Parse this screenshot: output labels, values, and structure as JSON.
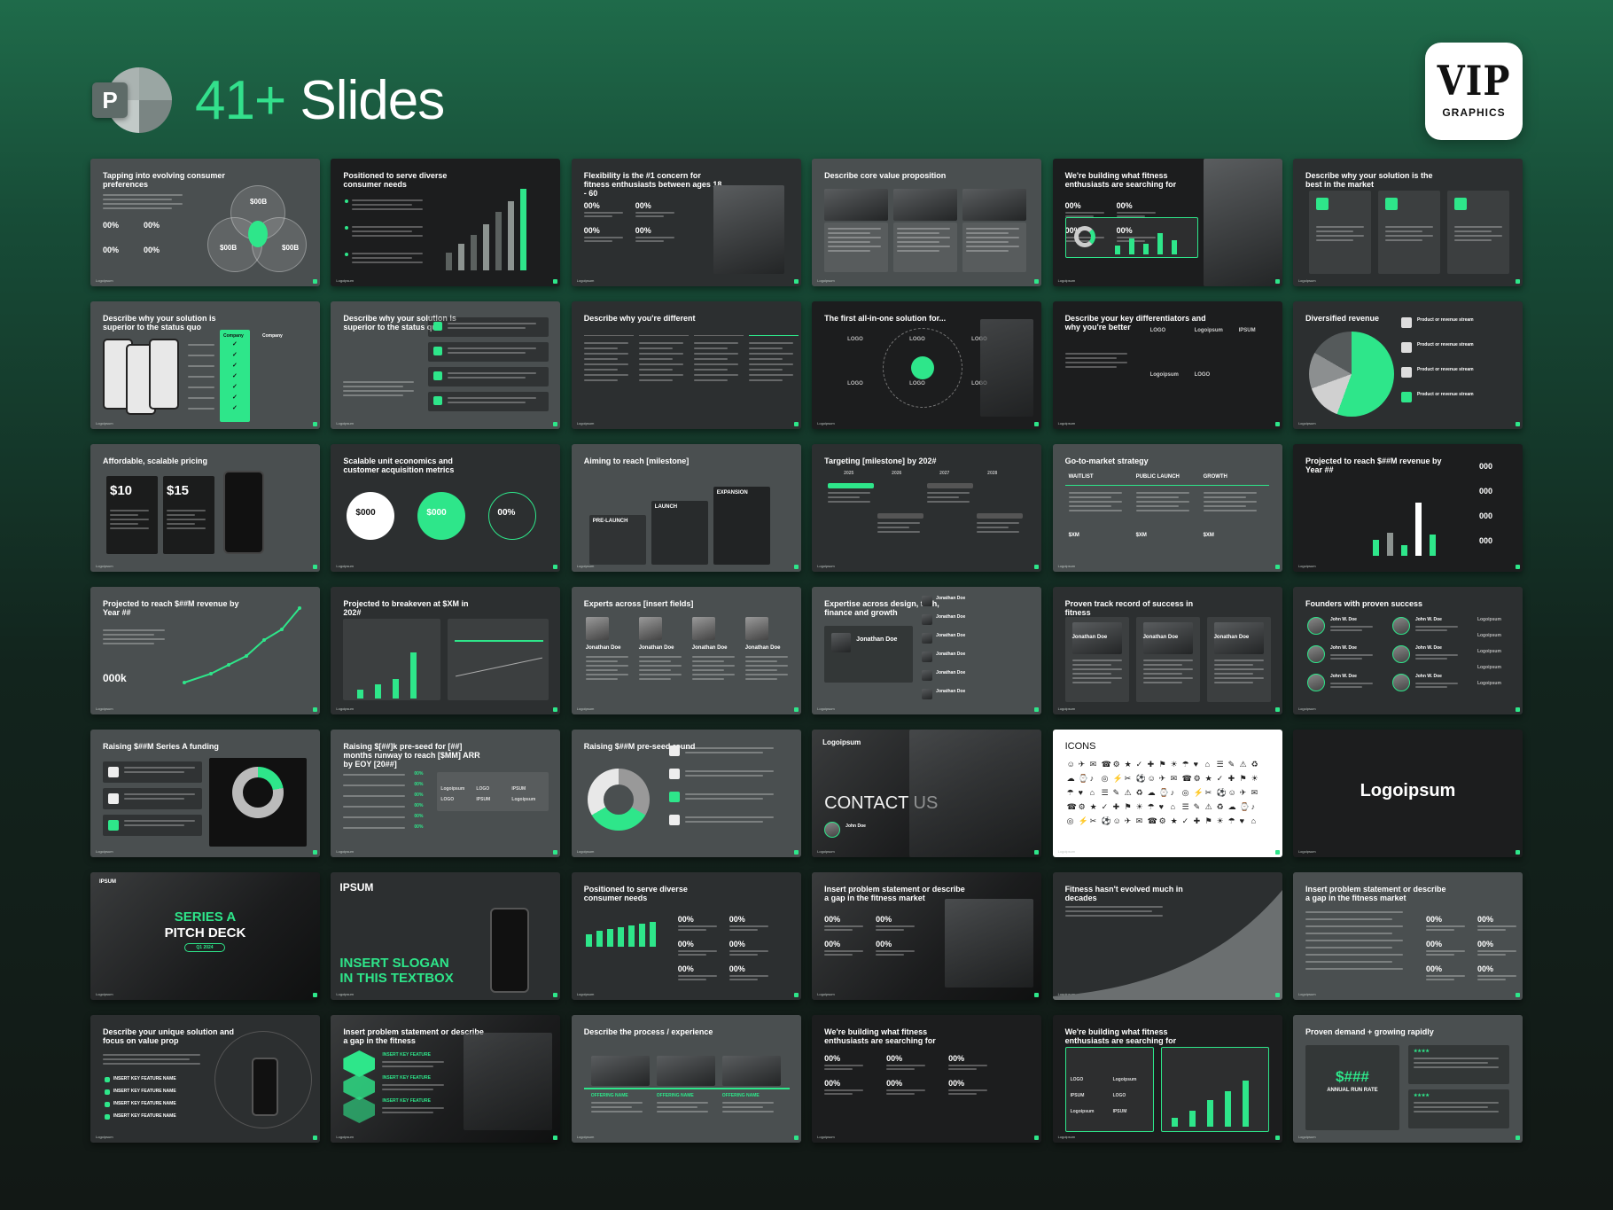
{
  "header": {
    "count": "41+",
    "word": "Slides",
    "app_letter": "P"
  },
  "badge": {
    "line1": "VIP",
    "line2": "GRAPHICS"
  },
  "footer_logo": "Logoipsum",
  "slides": [
    {
      "title": "Tapping into evolving consumer preferences",
      "kind": "venn",
      "bg": "gray",
      "v1": "$00B",
      "v2": "$00B",
      "v3": "$00B"
    },
    {
      "title": "Positioned to serve diverse consumer needs",
      "kind": "bars",
      "bg": "dark"
    },
    {
      "title": "Flexibility is the #1 concern for fitness enthusiasts between ages 18 - 60",
      "kind": "stats",
      "bg": "mid",
      "stat": "00%"
    },
    {
      "title": "Describe core value proposition",
      "kind": "three-photos",
      "bg": "gray"
    },
    {
      "title": "We're building what fitness enthusiasts are searching for",
      "kind": "stats-chart",
      "bg": "dark",
      "stat": "00%"
    },
    {
      "title": "Describe why your solution is the best in the market",
      "kind": "three-cards",
      "bg": "mid"
    },
    {
      "title": "Describe why your solution is superior to the status quo",
      "kind": "phones-table",
      "bg": "gray",
      "col1": "Company",
      "col2": "Company"
    },
    {
      "title": "Describe why your solution is superior to the status quo",
      "kind": "list4",
      "bg": "gray"
    },
    {
      "title": "Describe why you're different",
      "kind": "columns4",
      "bg": "mid"
    },
    {
      "title": "The first all-in-one solution for...",
      "kind": "hub",
      "bg": "dark"
    },
    {
      "title": "Describe your key differentiators and why you're better",
      "kind": "logos",
      "bg": "dark"
    },
    {
      "title": "Diversified revenue",
      "kind": "pie",
      "bg": "mid"
    },
    {
      "title": "Affordable, scalable pricing",
      "kind": "pricing",
      "bg": "gray",
      "p1": "$10",
      "p2": "$15"
    },
    {
      "title": "Scalable unit economics and customer acquisition metrics",
      "kind": "three-circles",
      "bg": "mid",
      "c1": "$000",
      "c2": "$000",
      "c3": "00%"
    },
    {
      "title": "Aiming to reach [milestone]",
      "kind": "steps",
      "bg": "gray",
      "s1": "PRE-LAUNCH",
      "s2": "LAUNCH",
      "s3": "EXPANSION"
    },
    {
      "title": "Targeting [milestone] by 202#",
      "kind": "timeline",
      "bg": "mid"
    },
    {
      "title": "Go-to-market strategy",
      "kind": "gtm",
      "bg": "gray",
      "g1": "WAITLIST",
      "g2": "PUBLIC LAUNCH",
      "g3": "GROWTH"
    },
    {
      "title": "Projected to reach $##M revenue by Year ##",
      "kind": "bars-kpi",
      "bg": "dark",
      "kpi": "000"
    },
    {
      "title": "Projected to reach $##M revenue by Year ##",
      "kind": "line",
      "bg": "gray",
      "kpi": "000k"
    },
    {
      "title": "Projected to breakeven at $XM in 202#",
      "kind": "two-charts",
      "bg": "mid"
    },
    {
      "title": "Experts across [insert fields]",
      "kind": "team4",
      "bg": "gray",
      "name": "Jonathan Doe"
    },
    {
      "title": "Expertise across design, tech, finance and growth",
      "kind": "team-list",
      "bg": "gray",
      "name": "Jonathan Doe"
    },
    {
      "title": "Proven track record of success in fitness",
      "kind": "team3",
      "bg": "mid",
      "name": "Jonathan Doe"
    },
    {
      "title": "Founders with proven success",
      "kind": "founders",
      "bg": "mid",
      "name": "John W. Doe"
    },
    {
      "title": "Raising $##M Series A funding",
      "kind": "donut-list",
      "bg": "gray"
    },
    {
      "title": "Raising $[##]k pre-seed for [##] months runway to reach [$MM] ARR by EOY [20##]",
      "kind": "table-logos",
      "bg": "gray"
    },
    {
      "title": "Raising $##M pre-seed round",
      "kind": "donut2",
      "bg": "gray"
    },
    {
      "title": "CONTACT US",
      "kind": "contact",
      "bg": "photo",
      "name": "John Doe"
    },
    {
      "title": "ICONS",
      "kind": "icons",
      "bg": "white"
    },
    {
      "title": "Logoipsum",
      "kind": "logo-center",
      "bg": "dark"
    },
    {
      "title": "SERIES A",
      "kind": "cover",
      "bg": "photo",
      "sub": "PITCH DECK",
      "tag": "Q1 2024"
    },
    {
      "title": "INSERT SLOGAN IN THIS TEXTBOX",
      "kind": "slogan",
      "bg": "mid",
      "brand": "IPSUM"
    },
    {
      "title": "Positioned to serve diverse consumer needs",
      "kind": "bars-stats",
      "bg": "mid",
      "stat": "00%"
    },
    {
      "title": "Insert problem statement or describe a gap in the fitness market",
      "kind": "problem-photo",
      "bg": "photo",
      "stat": "00%"
    },
    {
      "title": "Fitness hasn't evolved much in decades",
      "kind": "curve",
      "bg": "mid"
    },
    {
      "title": "Insert problem statement or describe a gap in the fitness market",
      "kind": "problem-list",
      "bg": "gray",
      "stat": "00%"
    },
    {
      "title": "Describe your unique solution and focus on value prop",
      "kind": "orbit-phone",
      "bg": "mid"
    },
    {
      "title": "Insert problem statement or describe a gap in the fitness",
      "kind": "layers",
      "bg": "photo"
    },
    {
      "title": "Describe the process / experience",
      "kind": "process",
      "bg": "gray"
    },
    {
      "title": "We're building what fitness enthusiasts are searching for",
      "kind": "three-stats",
      "bg": "dark",
      "stat": "00%"
    },
    {
      "title": "We're building what fitness enthusiasts are searching for",
      "kind": "logos-chart",
      "bg": "dark"
    },
    {
      "title": "Proven demand + growing rapidly",
      "kind": "arr",
      "bg": "gray",
      "big": "$###",
      "sub": "ANNUAL RUN RATE"
    }
  ]
}
